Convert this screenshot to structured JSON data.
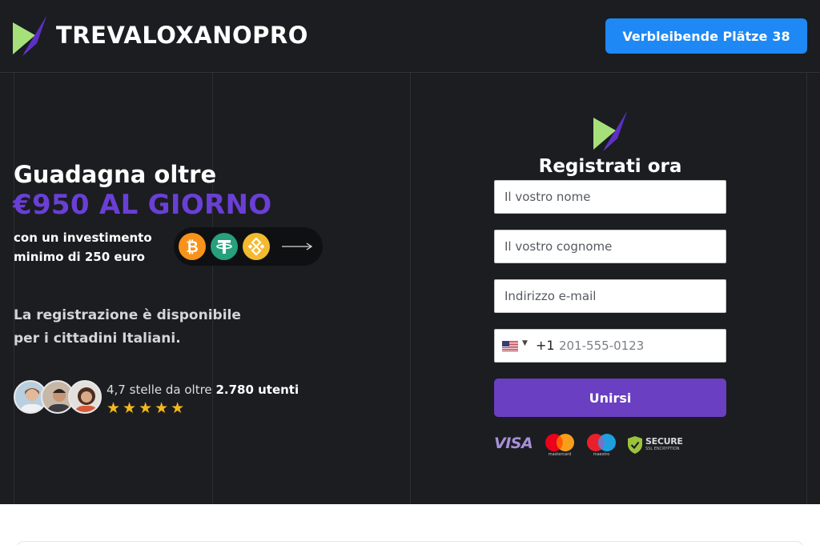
{
  "header": {
    "brand": "TREVALOXANOPRO",
    "seats_label": "Verbleibende Plätze",
    "seats_count": "38"
  },
  "hero": {
    "headline_1": "Guadagna oltre",
    "headline_2": "€950 AL GIORNO",
    "invest_line_1": "con un investimento",
    "invest_line_2": "minimo di 250 euro",
    "registration_line_1": "La registrazione è disponibile",
    "registration_line_2": "per i cittadini Italiani.",
    "rating_prefix": "4,7 stelle da oltre",
    "rating_users": "2.780 utenti",
    "stars": "★★★★★",
    "crypto_icons": [
      "bitcoin-icon",
      "tether-icon",
      "binance-icon"
    ]
  },
  "form": {
    "title": "Registrati ora",
    "first_name_placeholder": "Il vostro nome",
    "last_name_placeholder": "Il vostro cognome",
    "email_placeholder": "Indirizzo e-mail",
    "dial_code": "+1",
    "phone_placeholder": "201-555-0123",
    "submit_label": "Unirsi",
    "payment": {
      "visa": "VISA",
      "mastercard": "mastercard",
      "maestro": "maestro",
      "secure_title": "SECURE",
      "secure_sub": "SSL ENCRYPTION"
    }
  },
  "colors": {
    "background": "#1b1d21",
    "accent_purple": "#6a3fd6",
    "button_blue": "#1e88f5",
    "button_purple": "#6a3fc2",
    "logo_green": "#a6e07a"
  }
}
